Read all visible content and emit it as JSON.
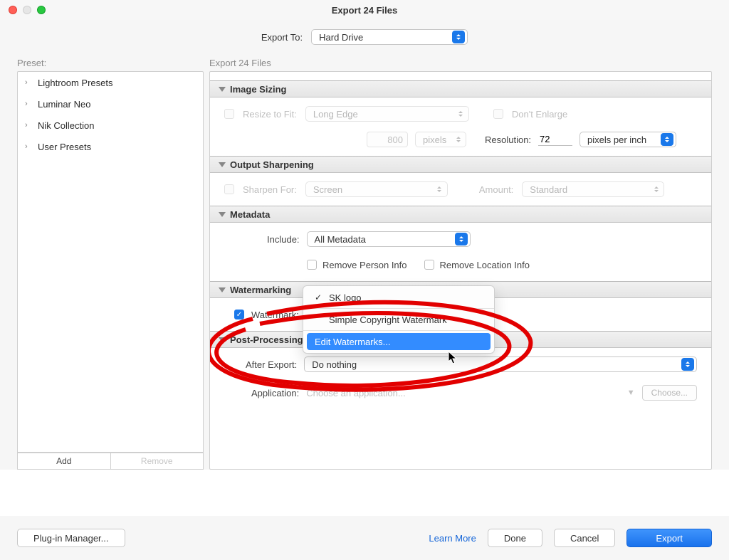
{
  "window": {
    "title": "Export 24 Files"
  },
  "exportTo": {
    "label": "Export To:",
    "value": "Hard Drive"
  },
  "columns": {
    "preset": "Preset:",
    "export": "Export 24 Files"
  },
  "sidebar": {
    "presets": [
      {
        "label": "Lightroom Presets"
      },
      {
        "label": "Luminar Neo"
      },
      {
        "label": "Nik Collection"
      },
      {
        "label": "User Presets"
      }
    ],
    "add": "Add",
    "remove": "Remove"
  },
  "sections": {
    "imageSizing": {
      "title": "Image Sizing",
      "resizeToFit": "Resize to Fit:",
      "fitMode": "Long Edge",
      "sizeValue": "800",
      "sizeUnit": "pixels",
      "dontEnlarge": "Don't Enlarge",
      "resolutionLabel": "Resolution:",
      "resolutionValue": "72",
      "resolutionUnit": "pixels per inch"
    },
    "outputSharpening": {
      "title": "Output Sharpening",
      "sharpenFor": "Sharpen For:",
      "sharpenTarget": "Screen",
      "amountLabel": "Amount:",
      "amountValue": "Standard"
    },
    "metadata": {
      "title": "Metadata",
      "includeLabel": "Include:",
      "includeValue": "All Metadata",
      "removePerson": "Remove Person Info",
      "removeLocation": "Remove Location Info"
    },
    "watermarking": {
      "title": "Watermarking",
      "watermarkLabel": "Watermark:",
      "menu": {
        "selected": "SK logo",
        "simple": "Simple Copyright Watermark",
        "edit": "Edit Watermarks..."
      }
    },
    "postProcessing": {
      "title": "Post-Processing",
      "afterExportLabel": "After Export:",
      "afterExportValue": "Do nothing",
      "applicationLabel": "Application:",
      "applicationPlaceholder": "Choose an application...",
      "chooseBtn": "Choose..."
    }
  },
  "footer": {
    "pluginManager": "Plug-in Manager...",
    "learnMore": "Learn More",
    "done": "Done",
    "cancel": "Cancel",
    "export": "Export"
  }
}
